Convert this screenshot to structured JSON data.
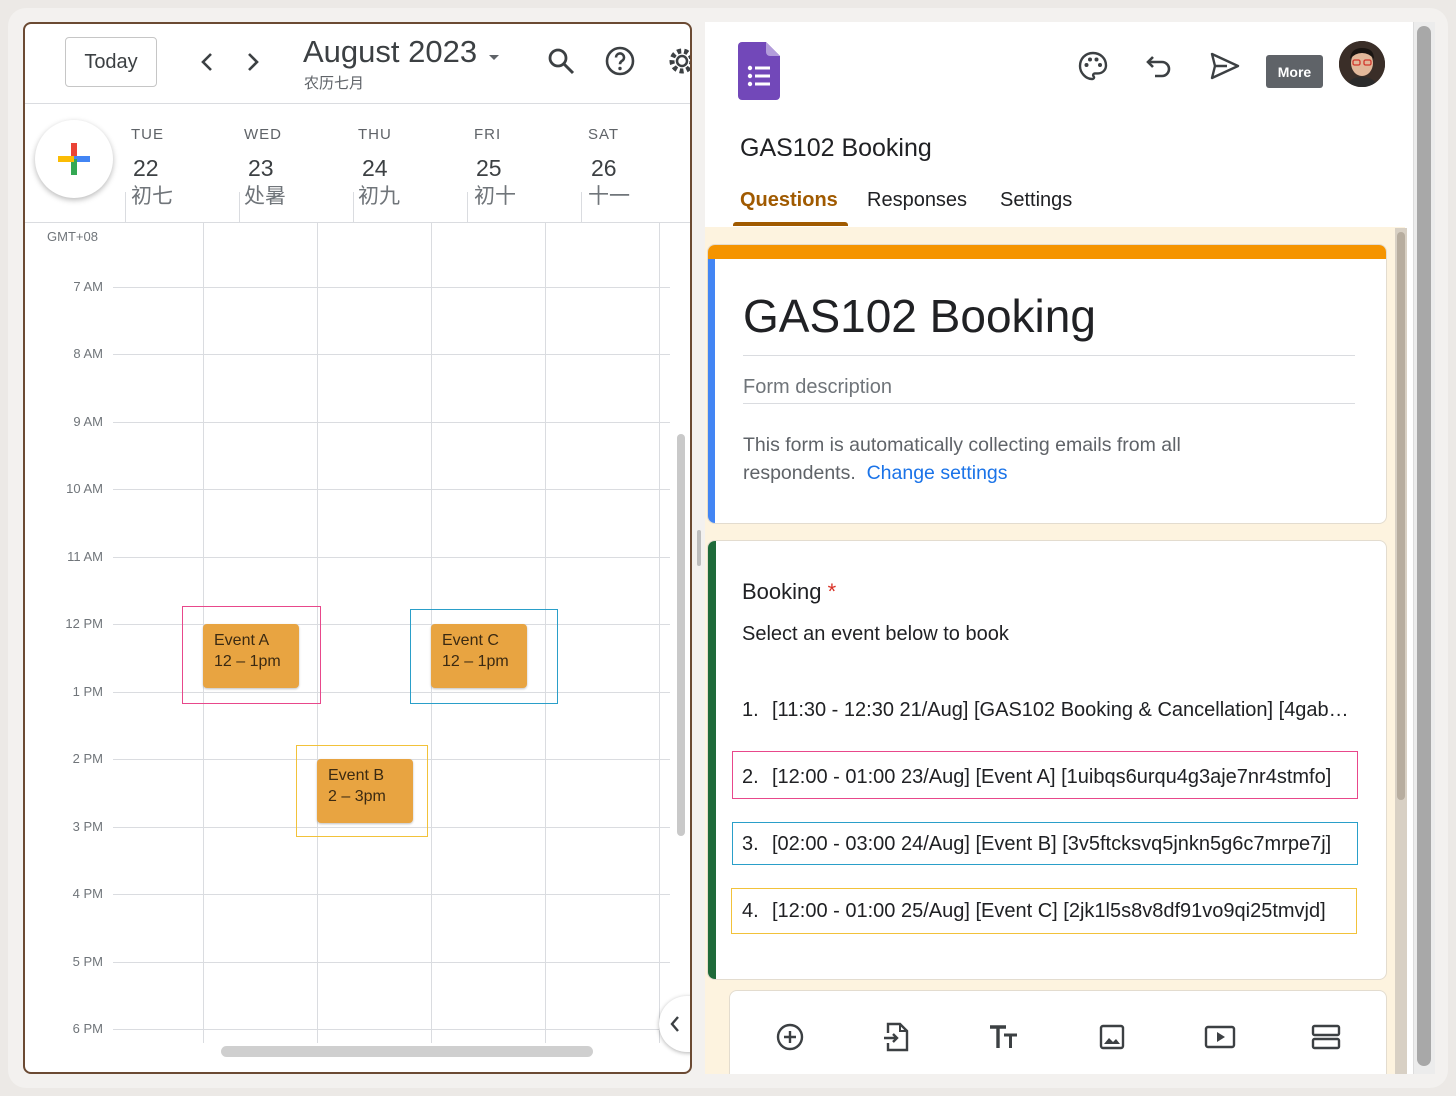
{
  "calendar": {
    "today_label": "Today",
    "month_title": "August 2023",
    "lunar_month": "农历七月",
    "timezone": "GMT+08",
    "days": [
      {
        "dow": "TUE",
        "num": "22",
        "lunar": "初七"
      },
      {
        "dow": "WED",
        "num": "23",
        "lunar": "处暑"
      },
      {
        "dow": "THU",
        "num": "24",
        "lunar": "初九"
      },
      {
        "dow": "FRI",
        "num": "25",
        "lunar": "初十"
      },
      {
        "dow": "SAT",
        "num": "26",
        "lunar": "十一"
      }
    ],
    "hours": [
      "7 AM",
      "8 AM",
      "9 AM",
      "10 AM",
      "11 AM",
      "12 PM",
      "1 PM",
      "2 PM",
      "3 PM",
      "4 PM",
      "5 PM",
      "6 PM"
    ],
    "events": [
      {
        "name": "Event A",
        "time": "12 – 1pm"
      },
      {
        "name": "Event C",
        "time": "12 – 1pm"
      },
      {
        "name": "Event B",
        "time": "2 – 3pm"
      }
    ],
    "event_color": "#e8a441"
  },
  "forms": {
    "more_tooltip": "More",
    "doc_title": "GAS102 Booking",
    "tabs": [
      "Questions",
      "Responses",
      "Settings"
    ],
    "form_title": "GAS102 Booking",
    "form_description_placeholder": "Form description",
    "notice_text": "This form is automatically collecting emails from all respondents.",
    "notice_link": "Change settings",
    "question": {
      "title": "Booking",
      "required_mark": "*",
      "description": "Select an event below to book",
      "options": [
        {
          "num": "1.",
          "text": "[11:30 - 12:30 21/Aug] [GAS102 Booking & Cancellation] [4gab…"
        },
        {
          "num": "2.",
          "text": "[12:00 - 01:00 23/Aug] [Event A] [1uibqs6urqu4g3aje7nr4stmfo]"
        },
        {
          "num": "3.",
          "text": "[02:00 - 03:00 24/Aug] [Event B] [3v5ftcksvq5jnkn5g6c7mrpe7j]"
        },
        {
          "num": "4.",
          "text": "[12:00 - 01:00 25/Aug] [Event C] [2jk1l5s8v8df91vo9qi25tmvjd]"
        }
      ]
    },
    "accent_color": "#f59400",
    "highlight_colors": {
      "pink": "#e8478b",
      "blue": "#2a9fc9",
      "yellow": "#f2c23a"
    }
  }
}
